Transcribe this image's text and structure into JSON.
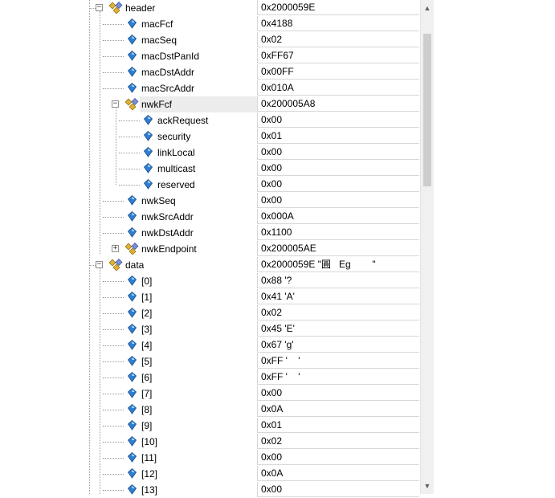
{
  "watch": {
    "rows": [
      {
        "name": "header",
        "value": "0x2000059E",
        "kind": "struct",
        "depth": 0,
        "expander": "minus"
      },
      {
        "name": "macFcf",
        "value": "0x4188",
        "kind": "field",
        "depth": 1
      },
      {
        "name": "macSeq",
        "value": "0x02",
        "kind": "field",
        "depth": 1
      },
      {
        "name": "macDstPanId",
        "value": "0xFF67",
        "kind": "field",
        "depth": 1
      },
      {
        "name": "macDstAddr",
        "value": "0x00FF",
        "kind": "field",
        "depth": 1
      },
      {
        "name": "macSrcAddr",
        "value": "0x010A",
        "kind": "field",
        "depth": 1
      },
      {
        "name": "nwkFcf",
        "value": "0x200005A8",
        "kind": "struct",
        "depth": 1,
        "expander": "minus",
        "selected": true
      },
      {
        "name": "ackRequest",
        "value": "0x00",
        "kind": "field",
        "depth": 2
      },
      {
        "name": "security",
        "value": "0x01",
        "kind": "field",
        "depth": 2
      },
      {
        "name": "linkLocal",
        "value": "0x00",
        "kind": "field",
        "depth": 2
      },
      {
        "name": "multicast",
        "value": "0x00",
        "kind": "field",
        "depth": 2
      },
      {
        "name": "reserved",
        "value": "0x00",
        "kind": "field",
        "depth": 2
      },
      {
        "name": "nwkSeq",
        "value": "0x00",
        "kind": "field",
        "depth": 1
      },
      {
        "name": "nwkSrcAddr",
        "value": "0x000A",
        "kind": "field",
        "depth": 1
      },
      {
        "name": "nwkDstAddr",
        "value": "0x1100",
        "kind": "field",
        "depth": 1
      },
      {
        "name": "nwkEndpoint",
        "value": "0x200005AE",
        "kind": "struct",
        "depth": 1,
        "expander": "plus"
      },
      {
        "name": "data",
        "value": "0x2000059E \"圓   Eg        \"",
        "kind": "struct",
        "depth": 0,
        "expander": "minus"
      },
      {
        "name": "[0]",
        "value": "0x88 '?",
        "kind": "field",
        "depth": 1
      },
      {
        "name": "[1]",
        "value": "0x41 'A'",
        "kind": "field",
        "depth": 1
      },
      {
        "name": "[2]",
        "value": "0x02",
        "kind": "field",
        "depth": 1
      },
      {
        "name": "[3]",
        "value": "0x45 'E'",
        "kind": "field",
        "depth": 1
      },
      {
        "name": "[4]",
        "value": "0x67 'g'",
        "kind": "field",
        "depth": 1
      },
      {
        "name": "[5]",
        "value": "0xFF '    '",
        "kind": "field",
        "depth": 1
      },
      {
        "name": "[6]",
        "value": "0xFF '    '",
        "kind": "field",
        "depth": 1
      },
      {
        "name": "[7]",
        "value": "0x00",
        "kind": "field",
        "depth": 1
      },
      {
        "name": "[8]",
        "value": "0x0A",
        "kind": "field",
        "depth": 1
      },
      {
        "name": "[9]",
        "value": "0x01",
        "kind": "field",
        "depth": 1
      },
      {
        "name": "[10]",
        "value": "0x02",
        "kind": "field",
        "depth": 1
      },
      {
        "name": "[11]",
        "value": "0x00",
        "kind": "field",
        "depth": 1
      },
      {
        "name": "[12]",
        "value": "0x0A",
        "kind": "field",
        "depth": 1
      },
      {
        "name": "[13]",
        "value": "0x00",
        "kind": "field",
        "depth": 1
      }
    ]
  },
  "scrollbar": {
    "up_glyph": "▲",
    "down_glyph": "▼"
  },
  "colors": {
    "grid_line": "#d7d7d7",
    "selection": "#ececec",
    "field_icon": "#2f7fd1",
    "struct_icon": "#e0b030"
  }
}
